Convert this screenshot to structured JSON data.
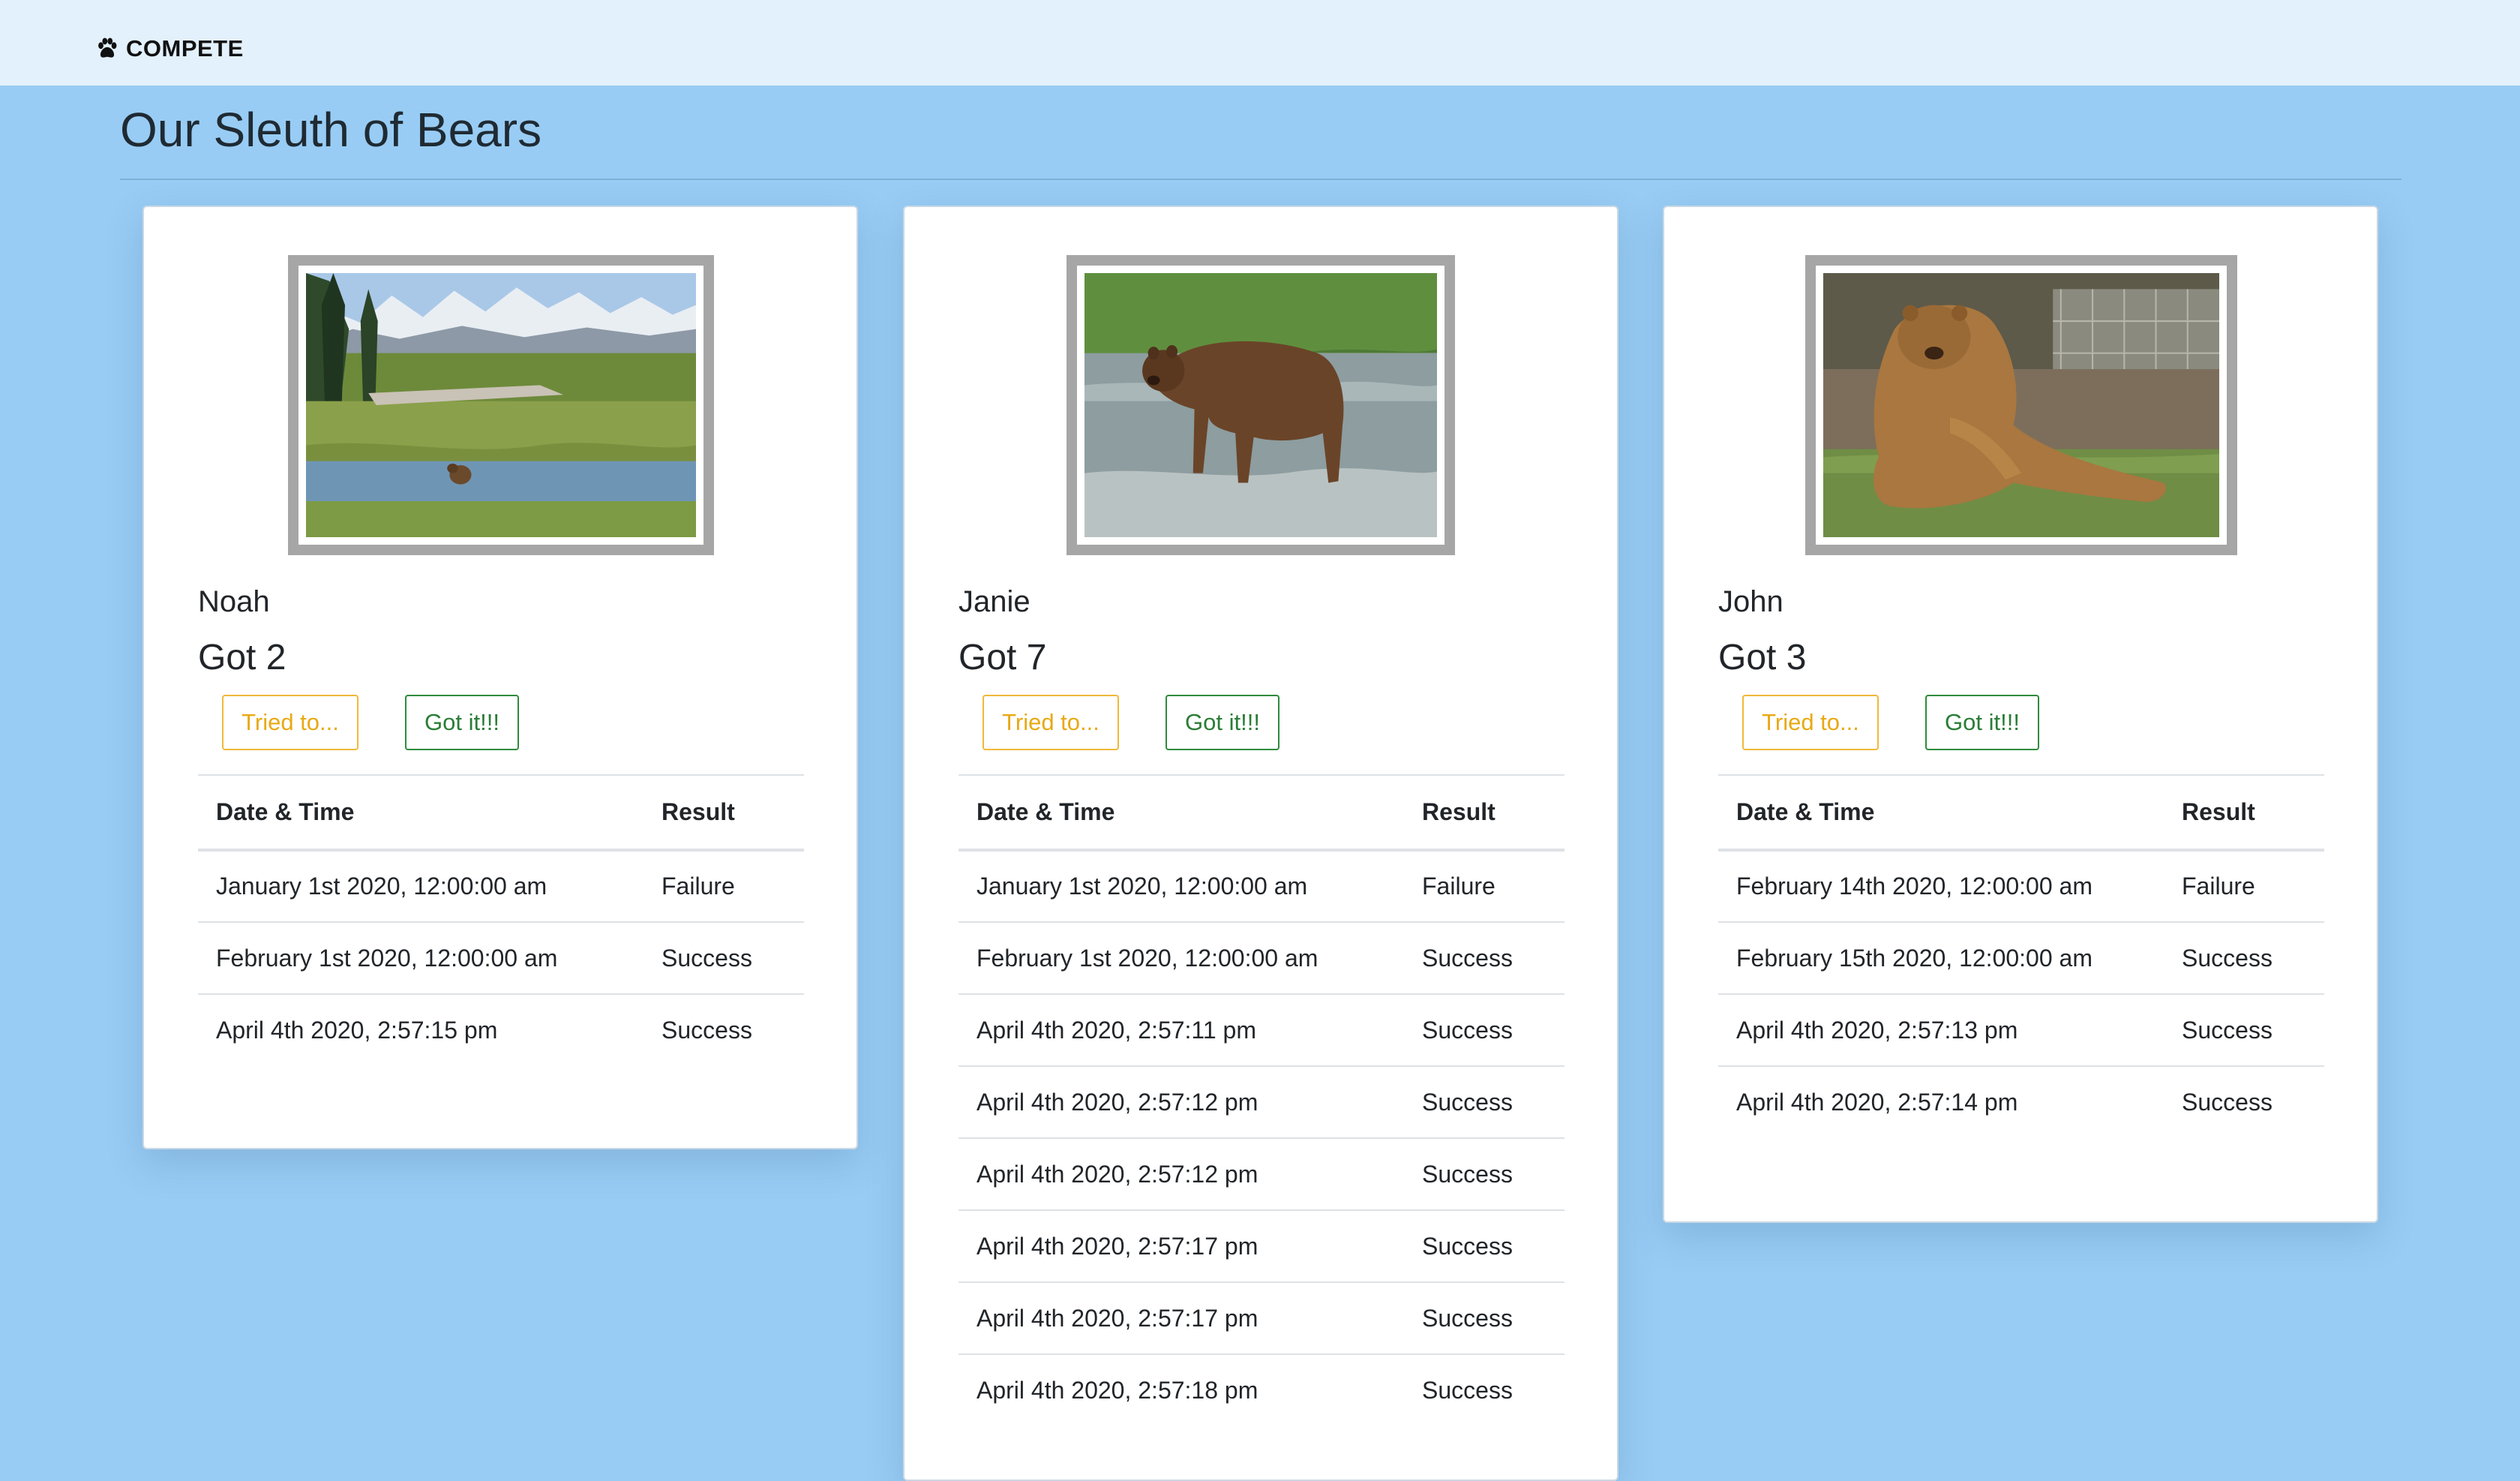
{
  "navbar": {
    "brand": "COMPETE",
    "brand_icon": "paw-icon"
  },
  "page": {
    "title": "Our Sleuth of Bears"
  },
  "buttons": {
    "tried": "Tried to...",
    "got": "Got it!!!"
  },
  "table_headers": {
    "datetime": "Date & Time",
    "result": "Result"
  },
  "bears": [
    {
      "name": "Noah",
      "got": "Got 2",
      "attempts": [
        {
          "datetime": "January 1st 2020, 12:00:00 am",
          "result": "Failure"
        },
        {
          "datetime": "February 1st 2020, 12:00:00 am",
          "result": "Success"
        },
        {
          "datetime": "April 4th 2020, 2:57:15 pm",
          "result": "Success"
        }
      ]
    },
    {
      "name": "Janie",
      "got": "Got 7",
      "attempts": [
        {
          "datetime": "January 1st 2020, 12:00:00 am",
          "result": "Failure"
        },
        {
          "datetime": "February 1st 2020, 12:00:00 am",
          "result": "Success"
        },
        {
          "datetime": "April 4th 2020, 2:57:11 pm",
          "result": "Success"
        },
        {
          "datetime": "April 4th 2020, 2:57:12 pm",
          "result": "Success"
        },
        {
          "datetime": "April 4th 2020, 2:57:12 pm",
          "result": "Success"
        },
        {
          "datetime": "April 4th 2020, 2:57:17 pm",
          "result": "Success"
        },
        {
          "datetime": "April 4th 2020, 2:57:17 pm",
          "result": "Success"
        },
        {
          "datetime": "April 4th 2020, 2:57:18 pm",
          "result": "Success"
        }
      ]
    },
    {
      "name": "John",
      "got": "Got 3",
      "attempts": [
        {
          "datetime": "February 14th 2020, 12:00:00 am",
          "result": "Failure"
        },
        {
          "datetime": "February 15th 2020, 12:00:00 am",
          "result": "Success"
        },
        {
          "datetime": "April 4th 2020, 2:57:13 pm",
          "result": "Success"
        },
        {
          "datetime": "April 4th 2020, 2:57:14 pm",
          "result": "Success"
        }
      ]
    }
  ],
  "colors": {
    "page_background": "#98ccf4",
    "navbar_background": "#e3f1fc",
    "warning_outline": "#f0b93a",
    "success_outline": "#2e8b3c"
  }
}
